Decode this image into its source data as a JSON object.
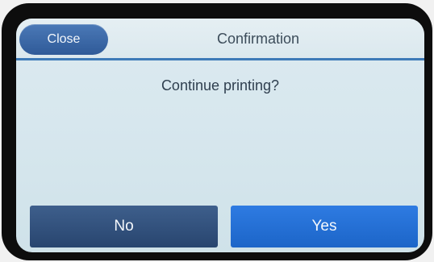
{
  "header": {
    "close_label": "Close",
    "title": "Confirmation"
  },
  "dialog": {
    "message": "Continue printing?"
  },
  "actions": {
    "no_label": "No",
    "yes_label": "Yes"
  },
  "colors": {
    "accent_blue": "#2e7be2",
    "dark_blue": "#28456f",
    "divider_blue": "#3d7ab8"
  }
}
